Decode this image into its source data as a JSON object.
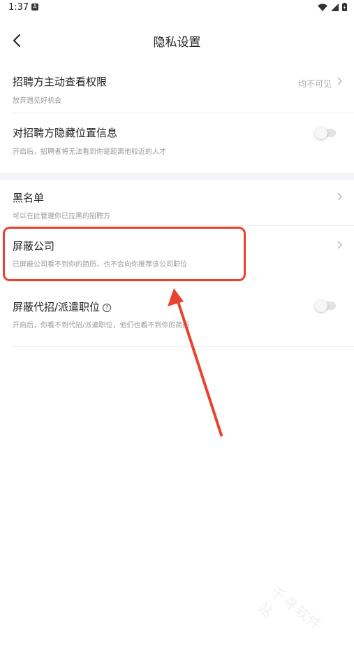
{
  "status_bar": {
    "time": "1:37",
    "notification_icon": "app-notification-icon",
    "icons": [
      "wifi-icon",
      "signal-icon",
      "battery-charging-icon"
    ]
  },
  "header": {
    "back_icon": "chevron-left-icon",
    "title": "隐私设置"
  },
  "settings": [
    {
      "title": "招聘方主动查看权限",
      "desc": "放弃遇见好机会",
      "value": "均不可见",
      "control": "chevron"
    },
    {
      "title": "对招聘方隐藏位置信息",
      "desc": "开启后，招聘者将无法看到你是距离他较近的人才",
      "control": "toggle",
      "enabled": false
    },
    {
      "title": "黑名单",
      "desc": "可以在此管理你已拉黑的招聘方",
      "control": "chevron"
    },
    {
      "title": "屏蔽公司",
      "desc": "已屏蔽公司看不到你的简历，也不会向你推荐该公司职位",
      "control": "chevron",
      "highlighted": true
    },
    {
      "title": "屏蔽代招/派遣职位",
      "desc": "开启后，你看不到代招/派遣职位，他们也看不到你的简历",
      "control": "toggle",
      "enabled": false,
      "help_icon": "question-circle-icon"
    }
  ],
  "annotation": {
    "color": "#e8432f"
  },
  "colors": {
    "section_gap": "#f3f4f7",
    "text_primary": "#222222",
    "text_secondary": "#999999"
  },
  "watermark": "千寻软件站"
}
